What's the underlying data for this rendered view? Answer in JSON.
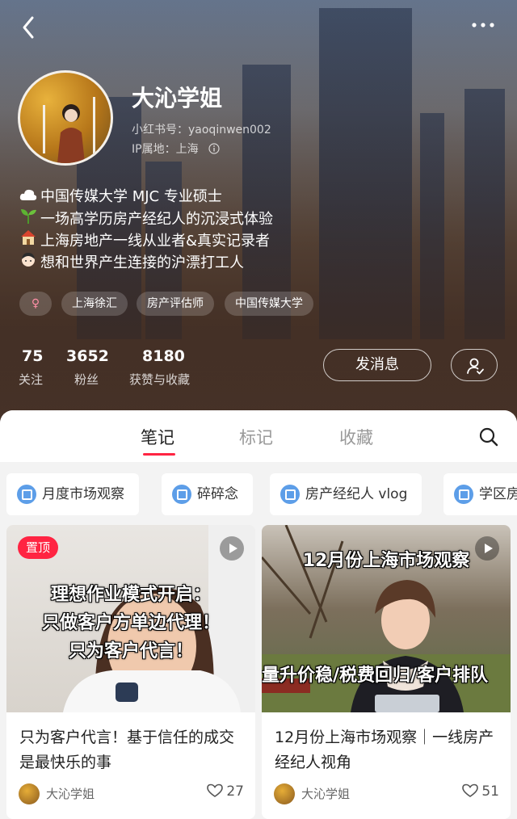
{
  "profile": {
    "name": "大沁学姐",
    "id_label": "小红书号：yaoqinwen002",
    "ip_label": "IP属地：上海",
    "bio": [
      {
        "icon": "cloud-icon",
        "text": "中国传媒大学 MJC 专业硕士"
      },
      {
        "icon": "seedling-icon",
        "text": "一场高学历房产经纪人的沉浸式体验"
      },
      {
        "icon": "house-icon",
        "text": "上海房地产一线从业者&真实记录者"
      },
      {
        "icon": "face-icon",
        "text": "想和世界产生连接的沪漂打工人"
      }
    ],
    "gender_symbol": "♀",
    "tags": [
      "上海徐汇",
      "房产评估师",
      "中国传媒大学"
    ],
    "stats": [
      {
        "num": "75",
        "label": "关注"
      },
      {
        "num": "3652",
        "label": "粉丝"
      },
      {
        "num": "8180",
        "label": "获赞与收藏"
      }
    ],
    "message_button": "发消息"
  },
  "tabs": [
    "笔记",
    "标记",
    "收藏"
  ],
  "active_tab": "笔记",
  "collections": [
    "月度市场观察",
    "碎碎念",
    "房产经纪人 vlog",
    "学区房"
  ],
  "notes": [
    {
      "pinned_label": "置顶",
      "cover_lines": [
        "理想作业模式开启：",
        "只做客户方单边代理！",
        "只为客户代言！"
      ],
      "title": "只为客户代言！基于信任的成交是最快乐的事",
      "author": "大沁学姐",
      "likes": "27"
    },
    {
      "cover_lines": [
        "12月份上海市场观察",
        "量升价稳/税费回归/客户排队"
      ],
      "title": "12月份上海市场观察｜一线房产经纪人视角",
      "author": "大沁学姐",
      "likes": "51"
    }
  ],
  "colors": {
    "accent": "#ff2442",
    "chip_icon": "#5d9ee8"
  }
}
